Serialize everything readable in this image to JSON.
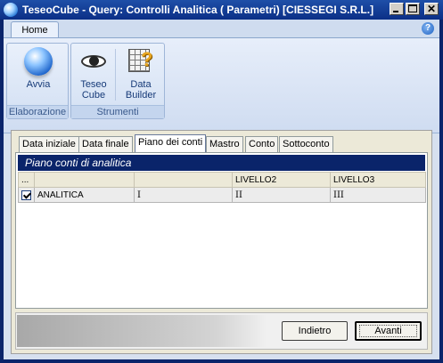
{
  "window": {
    "title": "TeseoCube - Query: Controlli Analitica ( Parametri) [CIESSEGI S.R.L.]"
  },
  "ribbon": {
    "tab": "Home",
    "groups": [
      {
        "label": "Elaborazione",
        "buttons": [
          {
            "label": "Avvia",
            "icon": "globe-icon"
          }
        ]
      },
      {
        "label": "Strumenti",
        "buttons": [
          {
            "label": "Teseo Cube",
            "icon": "eye-icon"
          },
          {
            "label": "Data Builder",
            "icon": "grid-question-icon"
          }
        ]
      }
    ]
  },
  "tabs": [
    "Data iniziale",
    "Data finale",
    "Piano dei conti",
    "Mastro",
    "Conto",
    "Sottoconto"
  ],
  "active_tab": "Piano dei conti",
  "section": {
    "title": "Piano conti di analitica"
  },
  "table": {
    "headers": [
      "...",
      "",
      "",
      "LIVELLO2",
      "LIVELLO3"
    ],
    "rows": [
      {
        "checked": true,
        "cells": [
          "ANALITICA",
          "I",
          "II",
          "III"
        ]
      }
    ]
  },
  "buttons": {
    "back": "Indietro",
    "next": "Avanti"
  }
}
